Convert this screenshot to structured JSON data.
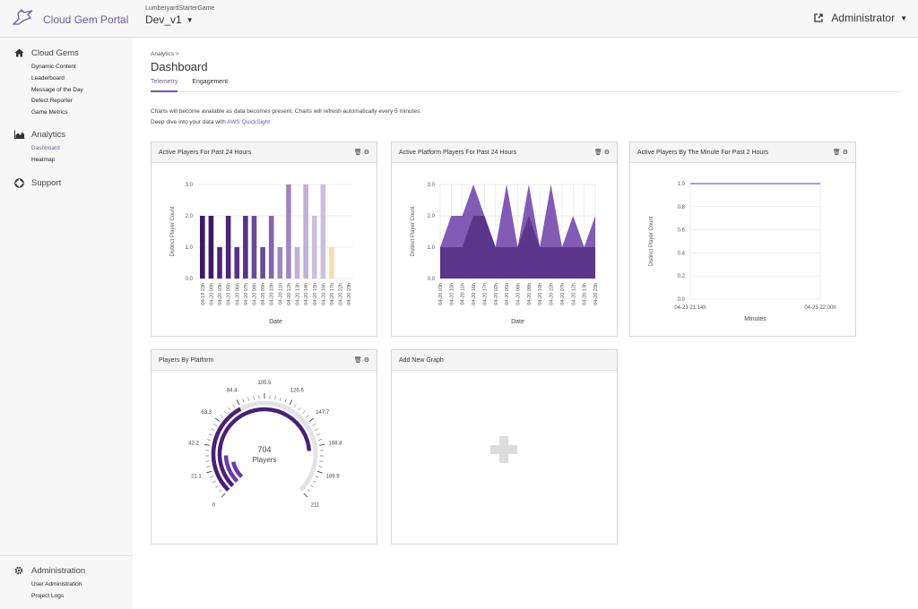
{
  "header": {
    "app_title": "Cloud Gem Portal",
    "project_name": "LumberyardStarterGame",
    "deployment": "Dev_v1",
    "user": "Administrator"
  },
  "sidebar": {
    "cloud_gems": {
      "label": "Cloud Gems",
      "items": [
        "Dynamic Content",
        "Leaderboard",
        "Message of the Day",
        "Defect Reporter",
        "Game Metrics"
      ]
    },
    "analytics": {
      "label": "Analytics",
      "items": [
        "Dashboard",
        "Heatmap"
      ],
      "active": "Dashboard"
    },
    "support": {
      "label": "Support"
    },
    "administration": {
      "label": "Administration",
      "items": [
        "User Administration",
        "Project Logs"
      ]
    }
  },
  "page": {
    "breadcrumb": "Analytics >",
    "title": "Dashboard",
    "tabs": [
      "Telemetry",
      "Engagement"
    ],
    "active_tab": "Telemetry",
    "info_line1": "Charts will become available as data becomes present. Charts will refresh automatically every 5 minutes.",
    "info_line2": "Deep dive into your data with",
    "info_link": "AWS QuickSight"
  },
  "cards": {
    "active_players_24h": "Active Players For Past 24 Hours",
    "active_platform_24h": "Active Platform Players For Past 24 Hours",
    "active_by_minute": "Active Players By The Minute For Past 2 Hours",
    "players_by_platform": "Players By Platform",
    "add_new_graph": "Add New Graph"
  },
  "colors": {
    "accent": "#6f5ba6",
    "sidebar_bg": "#f7f7f7",
    "bar_shades": [
      "#3d1a66",
      "#4a2578",
      "#56328a",
      "#6a4a9a",
      "#8565ad",
      "#a086c0",
      "#c0b0d8",
      "#cbbfdd",
      "#f3dfb7"
    ]
  },
  "chart_data": [
    {
      "type": "bar",
      "title": "Active Players For Past 24 Hours",
      "xlabel": "Date",
      "ylabel": "Distinct Player Count",
      "ylim": [
        0,
        3
      ],
      "yticks": [
        "0.0",
        "1.0",
        "2.0",
        "3.0"
      ],
      "categories": [
        "04-19 23h",
        "04-20 00h",
        "04-20 03h",
        "04-20 05h",
        "04-20 06h",
        "04-20 07h",
        "04-20 08h",
        "04-20 09h",
        "04-20 10h",
        "04-20 11h",
        "04-20 12h",
        "04-20 13h",
        "04-20 14h",
        "04-20 15h",
        "04-20 16h",
        "04-20 17h",
        "04-20 22h",
        "04-20 23h"
      ],
      "values": [
        2,
        2,
        1,
        2,
        1,
        2,
        2,
        1,
        2,
        1,
        3,
        1,
        3,
        2,
        3,
        1
      ]
    },
    {
      "type": "area",
      "title": "Active Platform Players For Past 24 Hours",
      "xlabel": "Date",
      "ylabel": "Distinct Player Count",
      "ylim": [
        0,
        3
      ],
      "yticks": [
        "0.0",
        "1.0",
        "2.0",
        "3.0"
      ],
      "categories": [
        "04-20 03h",
        "04-20 10h",
        "04-20 11h",
        "04-20 16h",
        "04-20 17h",
        "04-20 02h",
        "04-20 05h",
        "04-20 06h",
        "04-20 08h",
        "04-20 10h",
        "04-20 22h",
        "04-20 07h",
        "04-20 12h",
        "04-20 13h",
        "04-20 23h"
      ],
      "series": [
        {
          "values": [
            1,
            2,
            2,
            3,
            2,
            1,
            3,
            1,
            3,
            1,
            3,
            1,
            2,
            1,
            2
          ]
        },
        {
          "values": [
            1,
            1,
            1,
            2,
            2,
            1,
            1,
            1,
            2,
            1,
            1,
            1,
            1,
            1,
            1
          ]
        }
      ]
    },
    {
      "type": "line",
      "title": "Active Players By The Minute For Past 2 Hours",
      "xlabel": "Minutes",
      "ylabel": "Distinct Player Count",
      "ylim": [
        0,
        1
      ],
      "yticks": [
        "0.0",
        "0.2",
        "0.4",
        "0.6",
        "0.8",
        "1.0"
      ],
      "categories": [
        "04-23 21:14h",
        "04-23 22:00h"
      ],
      "values": [
        1,
        1
      ]
    },
    {
      "type": "gauge",
      "title": "Players By Platform",
      "total": 704,
      "unit": "Players",
      "range": [
        0,
        211
      ],
      "scale_labels": [
        "0",
        "21.1",
        "42.2",
        "63.3",
        "84.4",
        "105.5",
        "126.6",
        "147.7",
        "168.8",
        "189.9",
        "211"
      ]
    }
  ]
}
